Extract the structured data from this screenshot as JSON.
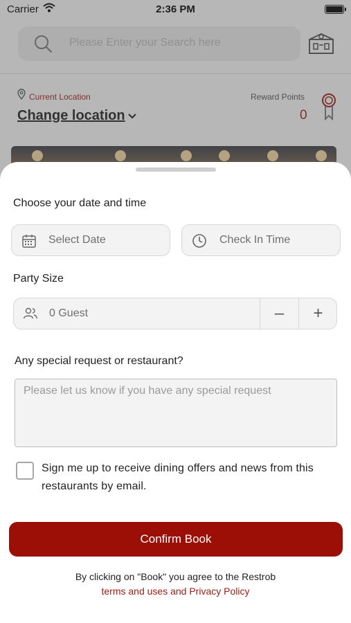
{
  "status_bar": {
    "carrier": "Carrier",
    "time": "2:36 PM"
  },
  "header": {
    "search_placeholder": "Please Enter your Search here",
    "location_label": "Current Location",
    "change_location": "Change location",
    "reward_label": "Reward Points",
    "reward_value": "0"
  },
  "sheet": {
    "date_time_title": "Choose your date and time",
    "date_field": "Select Date",
    "time_field": "Check In Time",
    "party_title": "Party Size",
    "guest_value": "0 Guest",
    "decrement": "–",
    "increment": "+",
    "request_title": "Any special request or restaurant?",
    "request_placeholder": "Please let us know if you have any special request",
    "offers_checkbox_label": "Sign me up to receive dining offers and news from this restaurants by email.",
    "offers_checked": false,
    "confirm_button": "Confirm Book",
    "terms_line": "By clicking on \"Book\" you agree to the Restrob",
    "terms_link": "terms and uses and Privacy Policy"
  },
  "colors": {
    "brand": "#9b0f07",
    "accent_text": "#9b1b12"
  },
  "icons": [
    "wifi-icon",
    "battery-icon",
    "search-icon",
    "restaurant-map-icon",
    "location-pin-icon",
    "chevron-down-icon",
    "medal-icon",
    "calendar-icon",
    "clock-icon",
    "guests-icon"
  ]
}
